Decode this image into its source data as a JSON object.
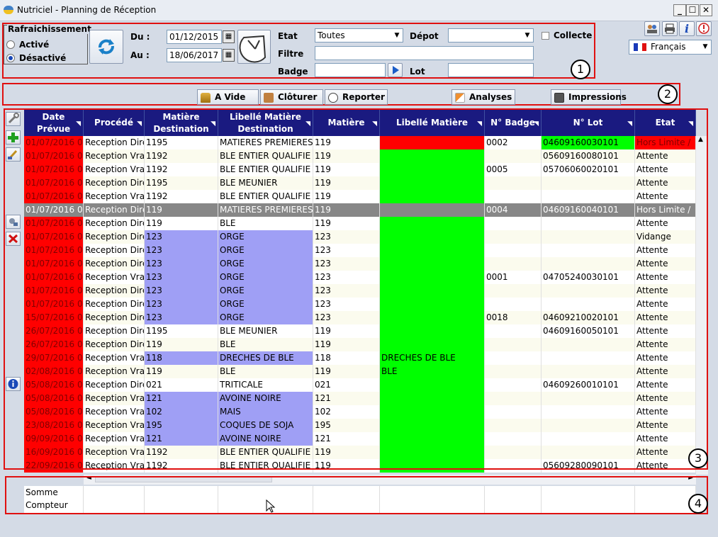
{
  "window": {
    "title": "Nutriciel - Planning de Réception",
    "min": "_",
    "max": "☐",
    "close": "✕"
  },
  "refresh": {
    "legend": "Rafraichissement",
    "active": "Activé",
    "inactive": "Désactivé",
    "selected": "Désactivé"
  },
  "dates": {
    "du_label": "Du :",
    "du": "01/12/2015",
    "au_label": "Au :",
    "au": "18/06/2017"
  },
  "filters": {
    "etat_label": "Etat",
    "etat": "Toutes",
    "depot_label": "Dépot",
    "depot": "",
    "collecte_label": "Collecte",
    "filtre_label": "Filtre",
    "filtre": "",
    "badge_label": "Badge",
    "badge": "",
    "lot_label": "Lot",
    "lot": ""
  },
  "language": "Français",
  "zones": [
    "1",
    "2",
    "3",
    "4"
  ],
  "toolbar": {
    "avide": "A Vide",
    "cloturer": "Clôturer",
    "reporter": "Reporter",
    "analyses": "Analyses",
    "impressions": "Impressions"
  },
  "table": {
    "headers": [
      "Date\nPrévue",
      "Procédé",
      "Matière\nDestination",
      "Libellé Matière\nDestination",
      "Matière",
      "Libellé Matière",
      "N° Badge",
      "N° Lot",
      "Etat"
    ],
    "rows": [
      [
        "01/07/2016 0",
        "Reception Dire",
        "1195",
        "MATIERES PREMIERES",
        "119",
        "",
        "0002",
        "04609160030101",
        "Hors Limite /"
      ],
      [
        "01/07/2016 0",
        "Reception Vra",
        "1192",
        "BLE ENTIER QUALIFIE",
        "119",
        "",
        "",
        "05609160080101",
        "Attente"
      ],
      [
        "01/07/2016 0",
        "Reception Vra",
        "1192",
        "BLE ENTIER QUALIFIE",
        "119",
        "",
        "0005",
        "05706060020101",
        "Attente"
      ],
      [
        "01/07/2016 0",
        "Reception Dire",
        "1195",
        "BLE MEUNIER",
        "119",
        "",
        "",
        "",
        "Attente"
      ],
      [
        "01/07/2016 0",
        "Reception Vra",
        "1192",
        "BLE ENTIER QUALIFIE",
        "119",
        "",
        "",
        "",
        "Attente"
      ],
      [
        "01/07/2016 0",
        "Reception Dire",
        "119",
        "MATIERES PREMIERES",
        "119",
        "",
        "0004",
        "04609160040101",
        "Hors Limite /"
      ],
      [
        "01/07/2016 0",
        "Reception Dire",
        "119",
        "BLE",
        "119",
        "",
        "",
        "",
        "Attente"
      ],
      [
        "01/07/2016 0",
        "Reception Dire",
        "123",
        "ORGE",
        "123",
        "",
        "",
        "",
        "Vidange"
      ],
      [
        "01/07/2016 0",
        "Reception Dire",
        "123",
        "ORGE",
        "123",
        "",
        "",
        "",
        "Attente"
      ],
      [
        "01/07/2016 0",
        "Reception Dire",
        "123",
        "ORGE",
        "123",
        "",
        "",
        "",
        "Attente"
      ],
      [
        "01/07/2016 0",
        "Reception Vra",
        "123",
        "ORGE",
        "123",
        "",
        "0001",
        "04705240030101",
        "Attente"
      ],
      [
        "01/07/2016 0",
        "Reception Dire",
        "123",
        "ORGE",
        "123",
        "",
        "",
        "",
        "Attente"
      ],
      [
        "01/07/2016 0",
        "Reception Dire",
        "123",
        "ORGE",
        "123",
        "",
        "",
        "",
        "Attente"
      ],
      [
        "15/07/2016 0",
        "Reception Dire",
        "123",
        "ORGE",
        "123",
        "",
        "0018",
        "04609210020101",
        "Attente"
      ],
      [
        "26/07/2016 0",
        "Reception Dire",
        "1195",
        "BLE MEUNIER",
        "119",
        "",
        "",
        "04609160050101",
        "Attente"
      ],
      [
        "26/07/2016 0",
        "Reception Dire",
        "119",
        "BLE",
        "119",
        "",
        "",
        "",
        "Attente"
      ],
      [
        "29/07/2016 0",
        "Reception Vra",
        "118",
        "DRECHES DE BLE",
        "118",
        "DRECHES DE BLE",
        "",
        "",
        "Attente"
      ],
      [
        "02/08/2016 0",
        "Reception Vra",
        "119",
        "BLE",
        "119",
        "BLE",
        "",
        "",
        "Attente"
      ],
      [
        "05/08/2016 0",
        "Reception Dire",
        "021",
        "TRITICALE",
        "021",
        "",
        "",
        "04609260010101",
        "Attente"
      ],
      [
        "05/08/2016 0",
        "Reception Vra",
        "121",
        "AVOINE NOIRE",
        "121",
        "",
        "",
        "",
        "Attente"
      ],
      [
        "05/08/2016 0",
        "Reception Vra",
        "102",
        "MAIS",
        "102",
        "",
        "",
        "",
        "Attente"
      ],
      [
        "23/08/2016 0",
        "Reception Vra",
        "195",
        "COQUES DE SOJA",
        "195",
        "",
        "",
        "",
        "Attente"
      ],
      [
        "09/09/2016 0",
        "Reception Vra",
        "121",
        "AVOINE NOIRE",
        "121",
        "",
        "",
        "",
        "Attente"
      ],
      [
        "16/09/2016 0",
        "Reception Vra",
        "1192",
        "BLE ENTIER QUALIFIE",
        "119",
        "",
        "",
        "",
        "Attente"
      ],
      [
        "22/09/2016 0",
        "Reception Vra",
        "1192",
        "BLE ENTIER QUALIFIE",
        "119",
        "",
        "",
        "05609280090101",
        "Attente"
      ]
    ],
    "selected_row": 5,
    "colors": {
      "date": "#ff0000",
      "date_text": "#800000",
      "purple": "#9f9ff5",
      "green": "#00ff00",
      "red": "#ff0000",
      "selected": "#878787",
      "alt": "#fbfbee"
    }
  },
  "footer": {
    "somme": "Somme",
    "compteur": "Compteur"
  }
}
